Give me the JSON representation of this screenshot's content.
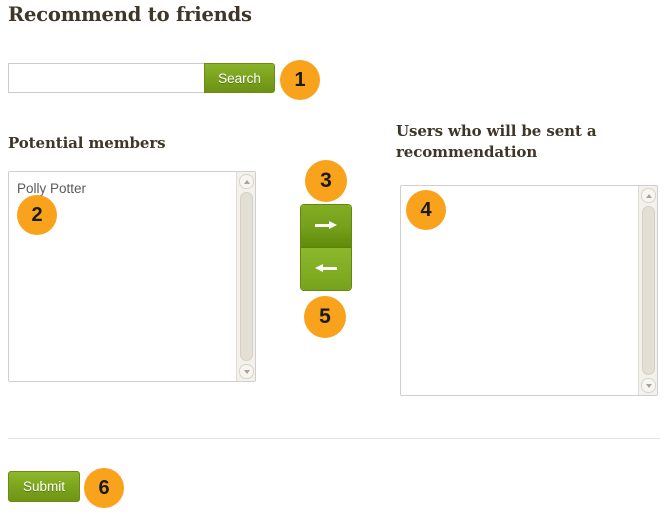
{
  "page": {
    "title": "Recommend to friends"
  },
  "search": {
    "value": "",
    "placeholder": "",
    "button_label": "Search"
  },
  "potential_members": {
    "heading": "Potential members",
    "options": [
      "Polly Potter"
    ]
  },
  "recipients": {
    "heading": "Users who will be sent a recommendation",
    "options": []
  },
  "transfer": {
    "add_icon": "arrow-right-icon",
    "remove_icon": "arrow-left-icon",
    "add_label": "",
    "remove_label": ""
  },
  "footer": {
    "submit_label": "Submit"
  },
  "callouts": [
    {
      "id": 1,
      "label": "1"
    },
    {
      "id": 2,
      "label": "2"
    },
    {
      "id": 3,
      "label": "3"
    },
    {
      "id": 4,
      "label": "4"
    },
    {
      "id": 5,
      "label": "5"
    },
    {
      "id": 6,
      "label": "6"
    }
  ],
  "colors": {
    "badge_background": "#f9a21b",
    "badge_text": "#1a1a1a",
    "button_green": "#7ca41e",
    "heading_text": "#3e3628",
    "body_text": "#5a5a5a",
    "border": "#cfcfcf",
    "divider": "#e5e5e5"
  }
}
